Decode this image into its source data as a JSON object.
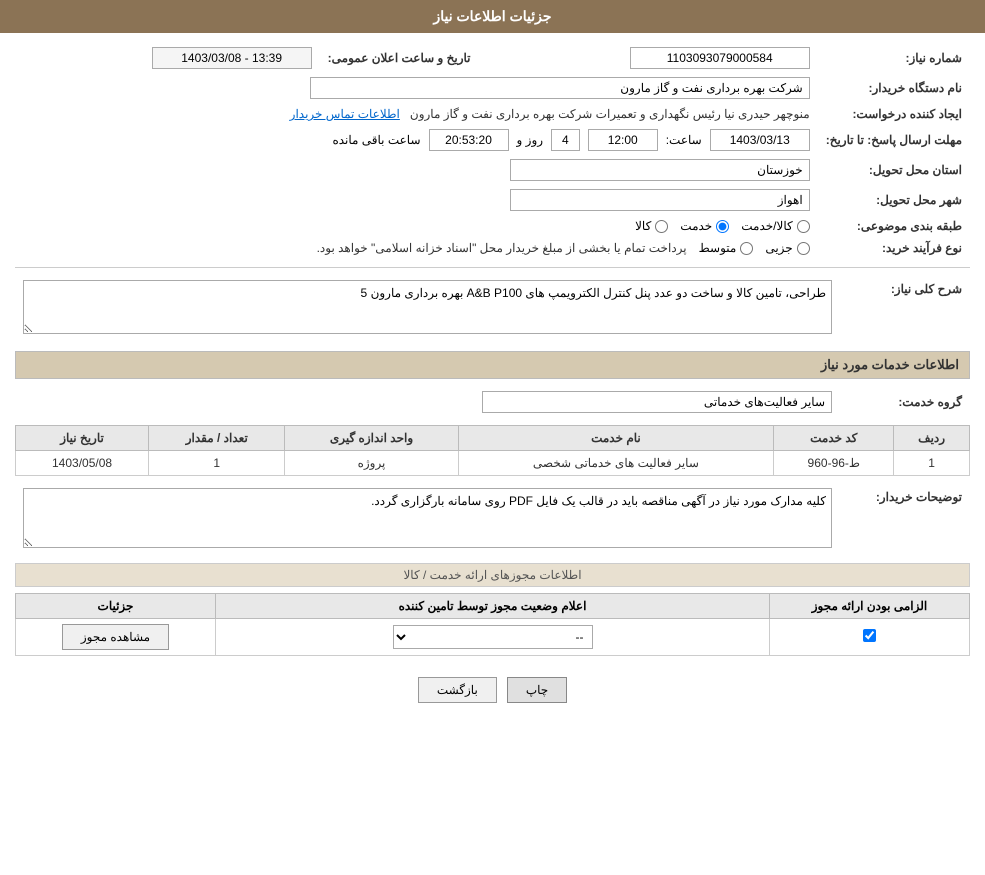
{
  "page": {
    "title": "جزئیات اطلاعات نیاز",
    "sections": {
      "basic_info": {
        "fields": {
          "shomara_niaz_label": "شماره نیاز:",
          "shomara_niaz_value": "1103093079000584",
          "nam_dastgah_label": "نام دستگاه خریدار:",
          "nam_dastgah_value": "شرکت بهره برداری نفت و گاز مارون",
          "ijad_konande_label": "ایجاد کننده درخواست:",
          "ijad_konande_value": "منوچهر حیدری نیا رئیس نگهداری و تعمیرات شرکت بهره برداری نفت و گاز مارون",
          "ijad_konande_link": "اطلاعات تماس خریدار",
          "mohlat_label": "مهلت ارسال پاسخ: تا تاریخ:",
          "mohlat_date": "1403/03/13",
          "mohlat_time_label": "ساعت:",
          "mohlat_time": "12:00",
          "mohlat_roz_label": "روز و",
          "mohlat_roz": "4",
          "mohlat_saat_label": "ساعت باقی مانده",
          "mohlat_saat": "20:53:20",
          "tarikh_label": "تاریخ و ساعت اعلان عمومی:",
          "tarikh_value": "1403/03/08 - 13:39",
          "ostan_label": "استان محل تحویل:",
          "ostan_value": "خوزستان",
          "shahr_label": "شهر محل تحویل:",
          "shahr_value": "اهواز",
          "tabaqe_label": "طبقه بندی موضوعی:",
          "tabaqe_kala": "کالا",
          "tabaqe_khadamat": "خدمت",
          "tabaqe_kala_khadamat": "کالا/خدمت",
          "selected_tabaqe": "خدمت",
          "nov_farayand_label": "نوع فرآیند خرید:",
          "nov_jazii": "جزیی",
          "nov_motavaset": "متوسط",
          "nov_note": "پرداخت تمام یا بخشی از مبلغ خریدار محل \"اسناد خزانه اسلامی\" خواهد بود."
        }
      },
      "sharh_niaz": {
        "title": "شرح کلی نیاز:",
        "value": "طراحی، تامین کالا و ساخت دو عدد پنل کنترل الکترویمپ های A&B P100 بهره برداری مارون 5"
      },
      "khadamat": {
        "title": "اطلاعات خدمات مورد نیاز",
        "group_label": "گروه خدمت:",
        "group_value": "سایر فعالیت‌های خدماتی",
        "table_headers": {
          "radif": "ردیف",
          "kod_khadamat": "کد خدمت",
          "nam_khadamat": "نام خدمت",
          "vahed": "واحد اندازه گیری",
          "tedad": "تعداد / مقدار",
          "tarikh": "تاریخ نیاز"
        },
        "table_rows": [
          {
            "radif": "1",
            "kod": "ط-96-960",
            "nam": "سایر فعالیت های خدماتی شخصی",
            "vahed": "پروژه",
            "tedad": "1",
            "tarikh": "1403/05/08"
          }
        ]
      },
      "tosihaat": {
        "label": "توضیحات خریدار:",
        "value": "کلیه مدارک مورد نیاز در آگهی مناقصه باید در قالب یک فایل PDF روی سامانه بارگزاری گردد."
      },
      "mojozha": {
        "title": "اطلاعات مجوزهای ارائه خدمت / کالا",
        "table_headers": {
          "elzami": "الزامی بودن ارائه مجوز",
          "elam": "اعلام وضعیت مجوز توسط تامین کننده",
          "joziyat": "جزئیات"
        },
        "table_rows": [
          {
            "elzami_checked": true,
            "elam_value": "--",
            "joziyat_btn": "مشاهده مجوز"
          }
        ]
      }
    },
    "buttons": {
      "chap": "چاپ",
      "bazgasht": "بازگشت"
    }
  }
}
